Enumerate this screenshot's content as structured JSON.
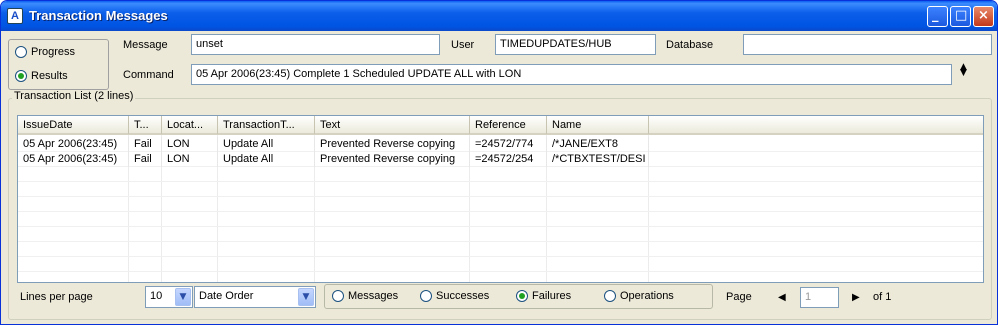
{
  "window": {
    "title": "Transaction Messages",
    "app_icon_letter": "A"
  },
  "mode": {
    "options": [
      "Progress",
      "Results"
    ],
    "selected": "Results"
  },
  "message": {
    "label": "Message",
    "value": "unset"
  },
  "user": {
    "label": "User",
    "value": "TIMEDUPDATES/HUB"
  },
  "database": {
    "label": "Database",
    "value": ""
  },
  "command": {
    "label": "Command",
    "value": "05 Apr 2006(23:45)  Complete  1  Scheduled UPDATE ALL with LON"
  },
  "list": {
    "title": "Transaction List (2 lines)",
    "columns": [
      "IssueDate",
      "T...",
      "Locat...",
      "TransactionT...",
      "Text",
      "Reference",
      "Name"
    ],
    "rows": [
      [
        "05 Apr 2006(23:45)",
        "Fail",
        "LON",
        "Update All",
        "Prevented Reverse copying",
        "=24572/774",
        "/*JANE/EXT8"
      ],
      [
        "05 Apr 2006(23:45)",
        "Fail",
        "LON",
        "Update All",
        "Prevented Reverse copying",
        "=24572/254",
        "/*CTBXTEST/DESI"
      ]
    ]
  },
  "footer": {
    "lines_per_page_label": "Lines per page",
    "lines_per_page": "10",
    "order": "Date Order",
    "filters": [
      "Messages",
      "Successes",
      "Failures",
      "Operations"
    ],
    "selected_filter": "Failures",
    "page_label": "Page",
    "page_value": "1",
    "of_label": "of 1"
  },
  "icons": {
    "minimize": "minimize-icon",
    "maximize": "maximize-icon",
    "close": "close-icon",
    "dropdown": "chevron-down-icon",
    "prev": "arrow-left-icon",
    "next": "arrow-right-icon",
    "spinner": "spinner-icon"
  }
}
